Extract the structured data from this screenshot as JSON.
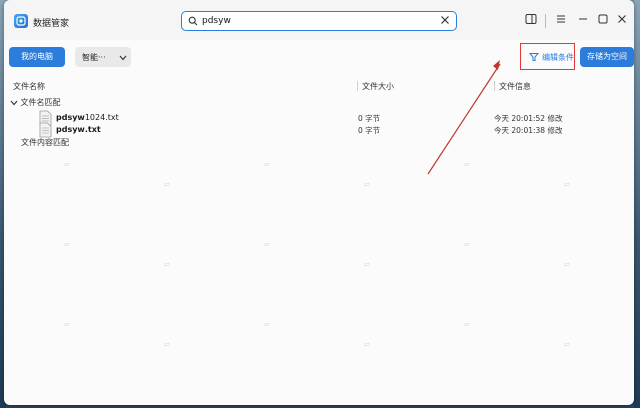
{
  "app": {
    "title": "数据管家"
  },
  "search": {
    "value": "pdsyw"
  },
  "toolbar": {
    "my_computer": "我的电脑",
    "mode": "智能···",
    "edit_conditions": "编辑条件",
    "save_as_space": "存储为空间"
  },
  "table": {
    "headers": {
      "name": "文件名称",
      "size": "文件大小",
      "info": "文件信息"
    },
    "groups": [
      {
        "label": "文件名匹配",
        "rows": [
          {
            "name_bold": "pdsyw",
            "name_rest": "1024.txt",
            "size": "0 字节",
            "info": "今天 20:01:52 修改"
          },
          {
            "name_bold": "pdsyw",
            "name_rest": ".txt",
            "size": "0 字节",
            "info": "今天 20:01:38 修改"
          }
        ]
      },
      {
        "label": "文件内容匹配",
        "rows": []
      }
    ]
  },
  "colors": {
    "accent": "#2b7cdb",
    "highlight_box": "#e03a3a",
    "arrow": "#c0392b"
  }
}
